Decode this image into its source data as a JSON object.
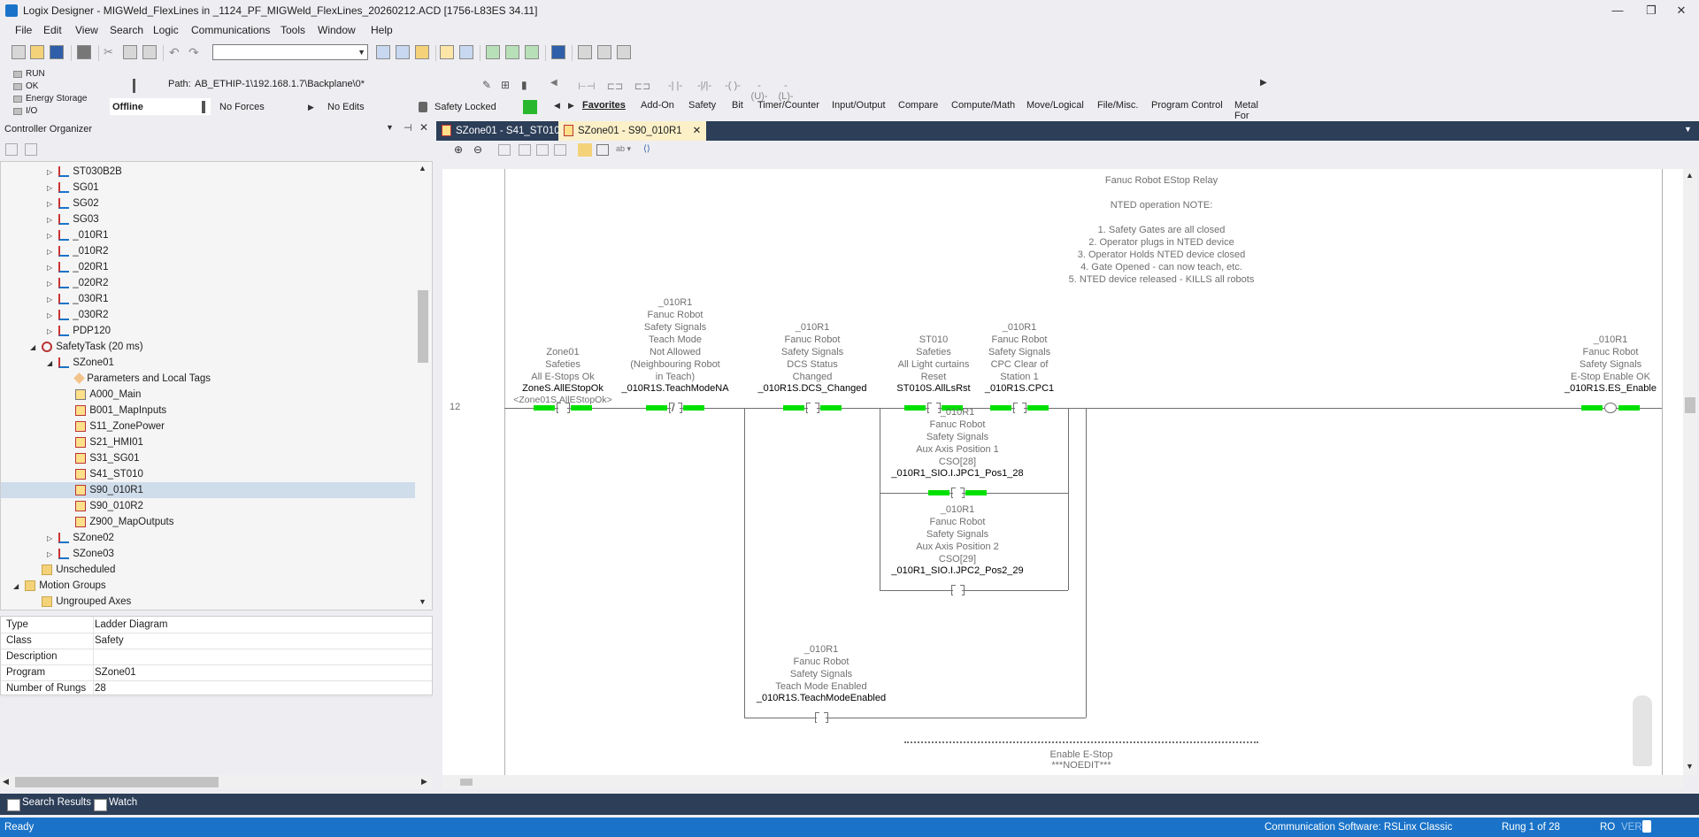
{
  "window": {
    "title": "Logix Designer - MIGWeld_FlexLines in _1124_PF_MIGWeld_FlexLines_20260212.ACD [1756-L83ES 34.11]",
    "minimize": "—",
    "restore": "❐",
    "close": "✕"
  },
  "menu": [
    "File",
    "Edit",
    "View",
    "Search",
    "Logic",
    "Communications",
    "Tools",
    "Window",
    "Help"
  ],
  "controller_status": {
    "leds": [
      "RUN",
      "OK",
      "Energy Storage",
      "I/O"
    ],
    "path_label": "Path:",
    "path_value": "AB_ETHIP-1\\192.168.1.7\\Backplane\\0*",
    "mode": "Offline",
    "forces": "No Forces",
    "edits": "No Edits",
    "safety": "Safety Locked"
  },
  "instruction_tabs": [
    "Favorites",
    "Add-On",
    "Safety",
    "Bit",
    "Timer/Counter",
    "Input/Output",
    "Compare",
    "Compute/Math",
    "Move/Logical",
    "File/Misc.",
    "Program Control",
    "Metal For"
  ],
  "organizer": {
    "title": "Controller Organizer",
    "tree": [
      {
        "label": "ST030B2B",
        "indent": 1,
        "icon": "prog",
        "exp": "▷"
      },
      {
        "label": "SG01",
        "indent": 1,
        "icon": "prog",
        "exp": "▷"
      },
      {
        "label": "SG02",
        "indent": 1,
        "icon": "prog",
        "exp": "▷"
      },
      {
        "label": "SG03",
        "indent": 1,
        "icon": "prog",
        "exp": "▷"
      },
      {
        "label": "_010R1",
        "indent": 1,
        "icon": "prog",
        "exp": "▷"
      },
      {
        "label": "_010R2",
        "indent": 1,
        "icon": "prog",
        "exp": "▷"
      },
      {
        "label": "_020R1",
        "indent": 1,
        "icon": "prog",
        "exp": "▷"
      },
      {
        "label": "_020R2",
        "indent": 1,
        "icon": "prog",
        "exp": "▷"
      },
      {
        "label": "_030R1",
        "indent": 1,
        "icon": "prog",
        "exp": "▷"
      },
      {
        "label": "_030R2",
        "indent": 1,
        "icon": "prog",
        "exp": "▷"
      },
      {
        "label": "PDP120",
        "indent": 1,
        "icon": "prog",
        "exp": "▷"
      },
      {
        "label": "SafetyTask (20 ms)",
        "indent": 0,
        "icon": "clock",
        "exp": "◢"
      },
      {
        "label": "SZone01",
        "indent": 1,
        "icon": "prog",
        "exp": "◢"
      },
      {
        "label": "Parameters and Local Tags",
        "indent": 2,
        "icon": "tags",
        "exp": ""
      },
      {
        "label": "A000_Main",
        "indent": 2,
        "icon": "main",
        "exp": ""
      },
      {
        "label": "B001_MapInputs",
        "indent": 2,
        "icon": "routine",
        "exp": ""
      },
      {
        "label": "S11_ZonePower",
        "indent": 2,
        "icon": "routine",
        "exp": ""
      },
      {
        "label": "S21_HMI01",
        "indent": 2,
        "icon": "routine",
        "exp": ""
      },
      {
        "label": "S31_SG01",
        "indent": 2,
        "icon": "routine",
        "exp": ""
      },
      {
        "label": "S41_ST010",
        "indent": 2,
        "icon": "routine",
        "exp": ""
      },
      {
        "label": "S90_010R1",
        "indent": 2,
        "icon": "routine",
        "exp": "",
        "selected": true
      },
      {
        "label": "S90_010R2",
        "indent": 2,
        "icon": "routine",
        "exp": ""
      },
      {
        "label": "Z900_MapOutputs",
        "indent": 2,
        "icon": "routine",
        "exp": ""
      },
      {
        "label": "SZone02",
        "indent": 1,
        "icon": "prog",
        "exp": "▷"
      },
      {
        "label": "SZone03",
        "indent": 1,
        "icon": "prog",
        "exp": "▷"
      },
      {
        "label": "Unscheduled",
        "indent": 0,
        "icon": "folder",
        "exp": ""
      },
      {
        "label": "Motion Groups",
        "indent": -1,
        "icon": "folder",
        "exp": "◢"
      },
      {
        "label": "Ungrouped Axes",
        "indent": 0,
        "icon": "folder",
        "exp": ""
      }
    ]
  },
  "properties": [
    {
      "k": "Type",
      "v": "Ladder Diagram"
    },
    {
      "k": "Class",
      "v": "Safety"
    },
    {
      "k": "Description",
      "v": ""
    },
    {
      "k": "Program",
      "v": "SZone01"
    },
    {
      "k": "Number of Rungs",
      "v": "28"
    }
  ],
  "bottom_tabs": [
    "Search Results",
    "Watch"
  ],
  "statusbar": {
    "left": "Ready",
    "comm": "Communication Software: RSLinx Classic",
    "rung": "Rung 1 of 28",
    "ro": "RO",
    "ver": "VER"
  },
  "editor": {
    "tabs": [
      "SZone01 - S41_ST010",
      "SZone01 - S90_010R1"
    ],
    "rung_number": "12",
    "rung_comment": [
      "Fanuc Robot EStop Relay",
      "",
      "NTED operation NOTE:",
      "",
      "1. Safety Gates are all closed",
      "2. Operator plugs in NTED device",
      "3. Operator Holds NTED device closed",
      "4. Gate Opened - can now teach, etc.",
      "5. NTED device released - KILLS all robots"
    ],
    "contacts": [
      {
        "desc": [
          "Zone01",
          "Safeties",
          "All E-Stops Ok"
        ],
        "tag": "ZoneS.AllEStopOk",
        "alias": "<Zone01S.AllEStopOk>"
      },
      {
        "desc": [
          "_010R1",
          "Fanuc Robot",
          "Safety Signals",
          "Teach Mode",
          "Not Allowed",
          "(Neighbouring Robot",
          "in Teach)"
        ],
        "tag": "_010R1S.TeachModeNA"
      },
      {
        "desc": [
          "_010R1",
          "Fanuc Robot",
          "Safety Signals",
          "DCS Status",
          "Changed"
        ],
        "tag": "_010R1S.DCS_Changed"
      },
      {
        "desc": [
          "ST010",
          "Safeties",
          "All Light curtains",
          "Reset"
        ],
        "tag": "ST010S.AllLsRst"
      },
      {
        "desc": [
          "_010R1",
          "Fanuc Robot",
          "Safety Signals",
          "CPC Clear of",
          "Station 1"
        ],
        "tag": "_010R1S.CPC1"
      },
      {
        "desc": [
          "_010R1",
          "Fanuc Robot",
          "Safety Signals",
          "Aux Axis Position 1",
          "CSO[28]"
        ],
        "tag": "_010R1_SIO.I.JPC1_Pos1_28"
      },
      {
        "desc": [
          "_010R1",
          "Fanuc Robot",
          "Safety Signals",
          "Aux Axis Position 2",
          "CSO[29]"
        ],
        "tag": "_010R1_SIO.I.JPC2_Pos2_29"
      },
      {
        "desc": [
          "_010R1",
          "Fanuc Robot",
          "Safety Signals",
          "Teach Mode Enabled"
        ],
        "tag": "_010R1S.TeachModeEnabled"
      }
    ],
    "coil": {
      "desc": [
        "_010R1",
        "Fanuc Robot",
        "Safety Signals",
        "E-Stop Enable OK"
      ],
      "tag": "_010R1S.ES_Enable"
    },
    "next_rung_comment": [
      "Enable E-Stop",
      "***NOEDIT***"
    ]
  }
}
